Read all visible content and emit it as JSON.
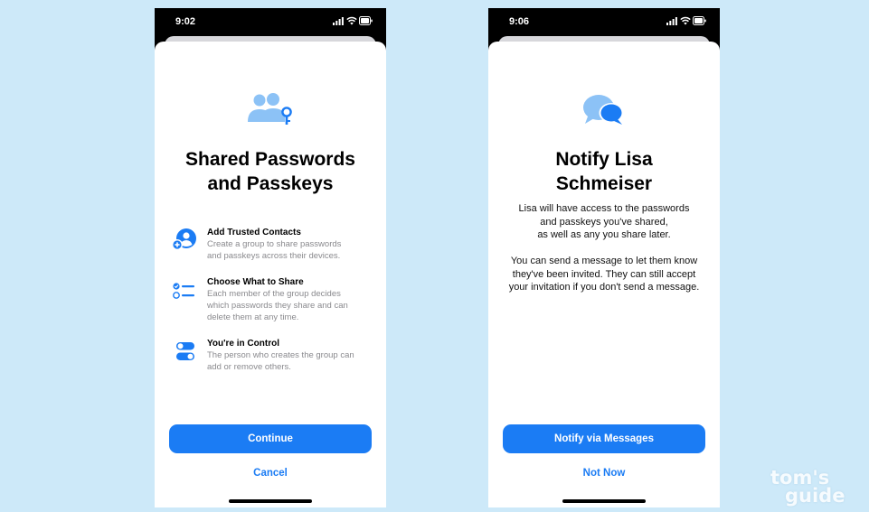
{
  "colors": {
    "background": "#cde9f9",
    "accent": "#1b7cf4",
    "icon_light": "#8cc2f6",
    "icon_dark": "#1b7cf4"
  },
  "watermark": {
    "line1": "tom's",
    "line2": "guide"
  },
  "left_screen": {
    "status_time": "9:02",
    "status_icons": [
      "signal-icon",
      "wifi-icon",
      "battery-icon"
    ],
    "hero_icon": "people-key-icon",
    "title_lines": [
      "Shared Passwords",
      "and Passkeys"
    ],
    "features": [
      {
        "icon": "person-add-icon",
        "title": "Add Trusted Contacts",
        "description_lines": [
          "Create a group to share passwords",
          "and passkeys across their devices."
        ]
      },
      {
        "icon": "checklist-icon",
        "title": "Choose What to Share",
        "description_lines": [
          "Each member of the group decides",
          "which passwords they share and can",
          "delete them at any time."
        ]
      },
      {
        "icon": "toggles-icon",
        "title": "You're in Control",
        "description_lines": [
          "The person who creates the group can",
          "add or remove others."
        ]
      }
    ],
    "primary_button": "Continue",
    "secondary_button": "Cancel"
  },
  "right_screen": {
    "status_time": "9:06",
    "status_icons": [
      "signal-icon",
      "wifi-icon",
      "battery-icon"
    ],
    "hero_icon": "message-bubbles-icon",
    "title_lines": [
      "Notify Lisa",
      "Schmeiser"
    ],
    "paragraph1_lines": [
      "Lisa will have access to the passwords",
      "and passkeys you've shared,",
      "as well as any you share later."
    ],
    "paragraph2_lines": [
      "You can send a message to let them know",
      "they've been invited. They can still accept",
      "your invitation if you don't send a message."
    ],
    "primary_button": "Notify via Messages",
    "secondary_button": "Not Now"
  }
}
